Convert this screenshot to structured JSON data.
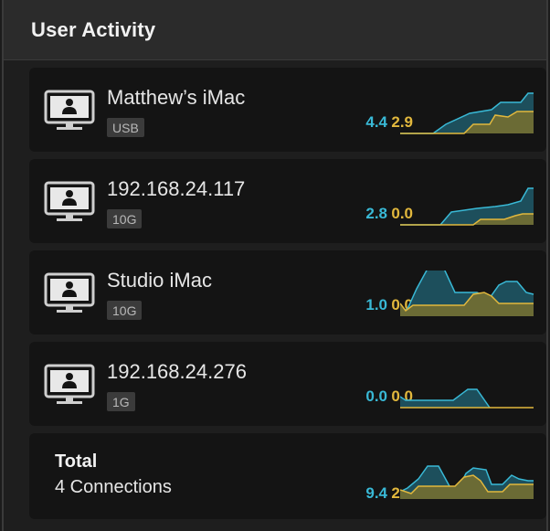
{
  "panel": {
    "title": "User Activity"
  },
  "rows": [
    {
      "name": "Matthew’s iMac",
      "badge": "USB",
      "value_a": "4.4",
      "value_b": "2.9"
    },
    {
      "name": "192.168.24.117",
      "badge": "10G",
      "value_a": "2.8",
      "value_b": "0.0"
    },
    {
      "name": "Studio iMac",
      "badge": "10G",
      "value_a": "1.0",
      "value_b": "0.0"
    },
    {
      "name": "192.168.24.276",
      "badge": "1G",
      "value_a": "0.0",
      "value_b": "0.0"
    }
  ],
  "total": {
    "title": "Total",
    "subtitle": "4 Connections",
    "value_a": "9.4",
    "value_b": "2.9"
  },
  "colors": {
    "series_a": "#39b9d6",
    "series_b": "#e2b83d",
    "fill_a": "#1d4f5c",
    "fill_b": "#6b6b35"
  },
  "icons": {
    "device": "computer-user-icon"
  }
}
